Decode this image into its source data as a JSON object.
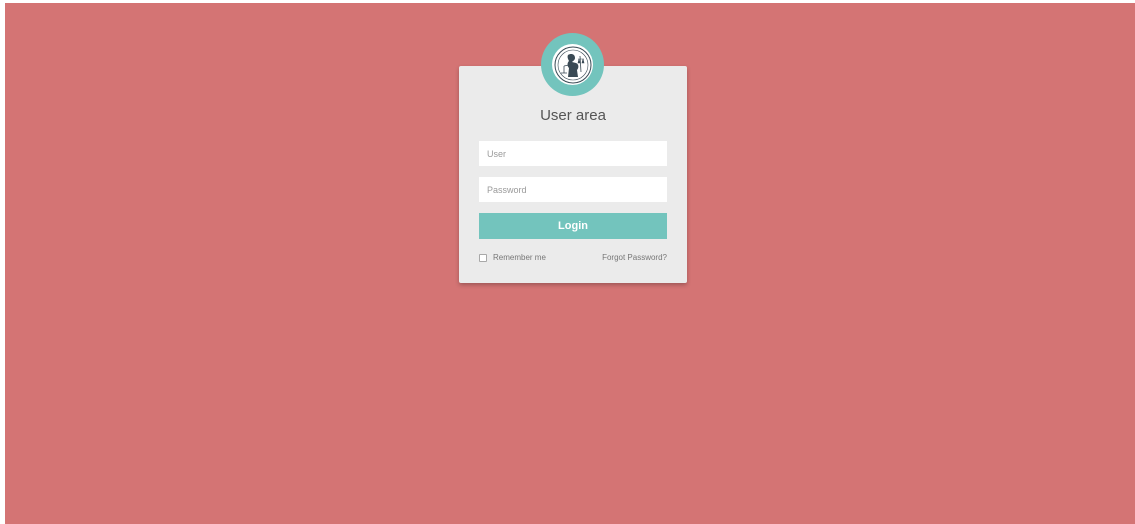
{
  "login_card": {
    "title": "User area",
    "user_field": {
      "placeholder": "User",
      "value": ""
    },
    "password_field": {
      "placeholder": "Password",
      "value": ""
    },
    "login_button_label": "Login",
    "remember_label": "Remember me",
    "remember_checked": false,
    "forgot_link_label": "Forgot Password?",
    "avatar_icon": "lady-justice-emblem"
  },
  "colors": {
    "background": "#d47474",
    "card": "#ebebeb",
    "accent": "#73c4bd",
    "button_text": "#ffffff"
  }
}
